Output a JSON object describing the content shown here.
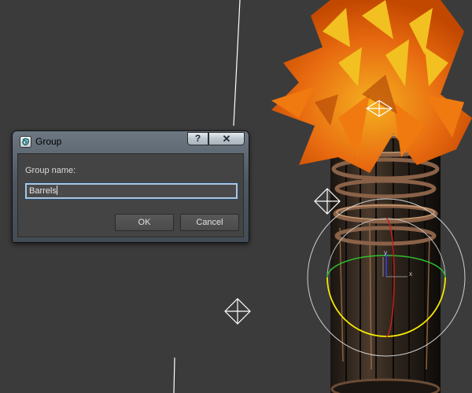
{
  "dialog": {
    "title": "Group",
    "label": "Group name:",
    "input_value": "Barrels",
    "ok_label": "OK",
    "cancel_label": "Cancel",
    "help_glyph": "?",
    "close_glyph": "✕"
  },
  "icons": {
    "app": "3dsmax-logo-icon",
    "help": "help-icon",
    "close": "close-icon",
    "helpers": "point-helper-icon"
  },
  "colors": {
    "viewport_background": "#3b3b3b",
    "flame_orange": "#f07a10",
    "flame_yellow": "#f2c020",
    "gizmo_green": "#2ec02e",
    "gizmo_yellow": "#f5e800",
    "gizmo_red": "#c82020",
    "gizmo_blue": "#3040ff"
  }
}
